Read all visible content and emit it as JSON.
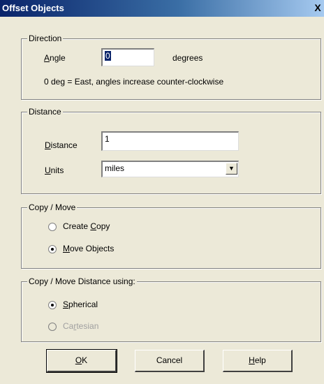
{
  "window": {
    "title": "Offset Objects",
    "close_glyph": "X"
  },
  "direction": {
    "legend": "Direction",
    "angle_label_u": "A",
    "angle_label_rest": "ngle",
    "angle_value": "0",
    "units_suffix": "degrees",
    "hint": "0 deg = East, angles increase counter-clockwise"
  },
  "distance": {
    "legend": "Distance",
    "distance_label_u": "D",
    "distance_label_rest": "istance",
    "distance_value": "1",
    "units_label_u": "U",
    "units_label_rest": "nits",
    "units_value": "miles"
  },
  "copy_move": {
    "legend": "Copy / Move",
    "create_copy_pre": "Create ",
    "create_copy_u": "C",
    "create_copy_post": "opy",
    "create_copy_checked": false,
    "move_objects_u": "M",
    "move_objects_post": "ove Objects",
    "move_objects_checked": true
  },
  "distance_using": {
    "legend": "Copy / Move Distance using:",
    "spherical_u": "S",
    "spherical_post": "pherical",
    "spherical_checked": true,
    "cartesian_pre": "Ca",
    "cartesian_u": "r",
    "cartesian_post": "tesian",
    "cartesian_enabled": false
  },
  "buttons": {
    "ok_u": "O",
    "ok_post": "K",
    "cancel": "Cancel",
    "help_u": "H",
    "help_post": "elp"
  }
}
